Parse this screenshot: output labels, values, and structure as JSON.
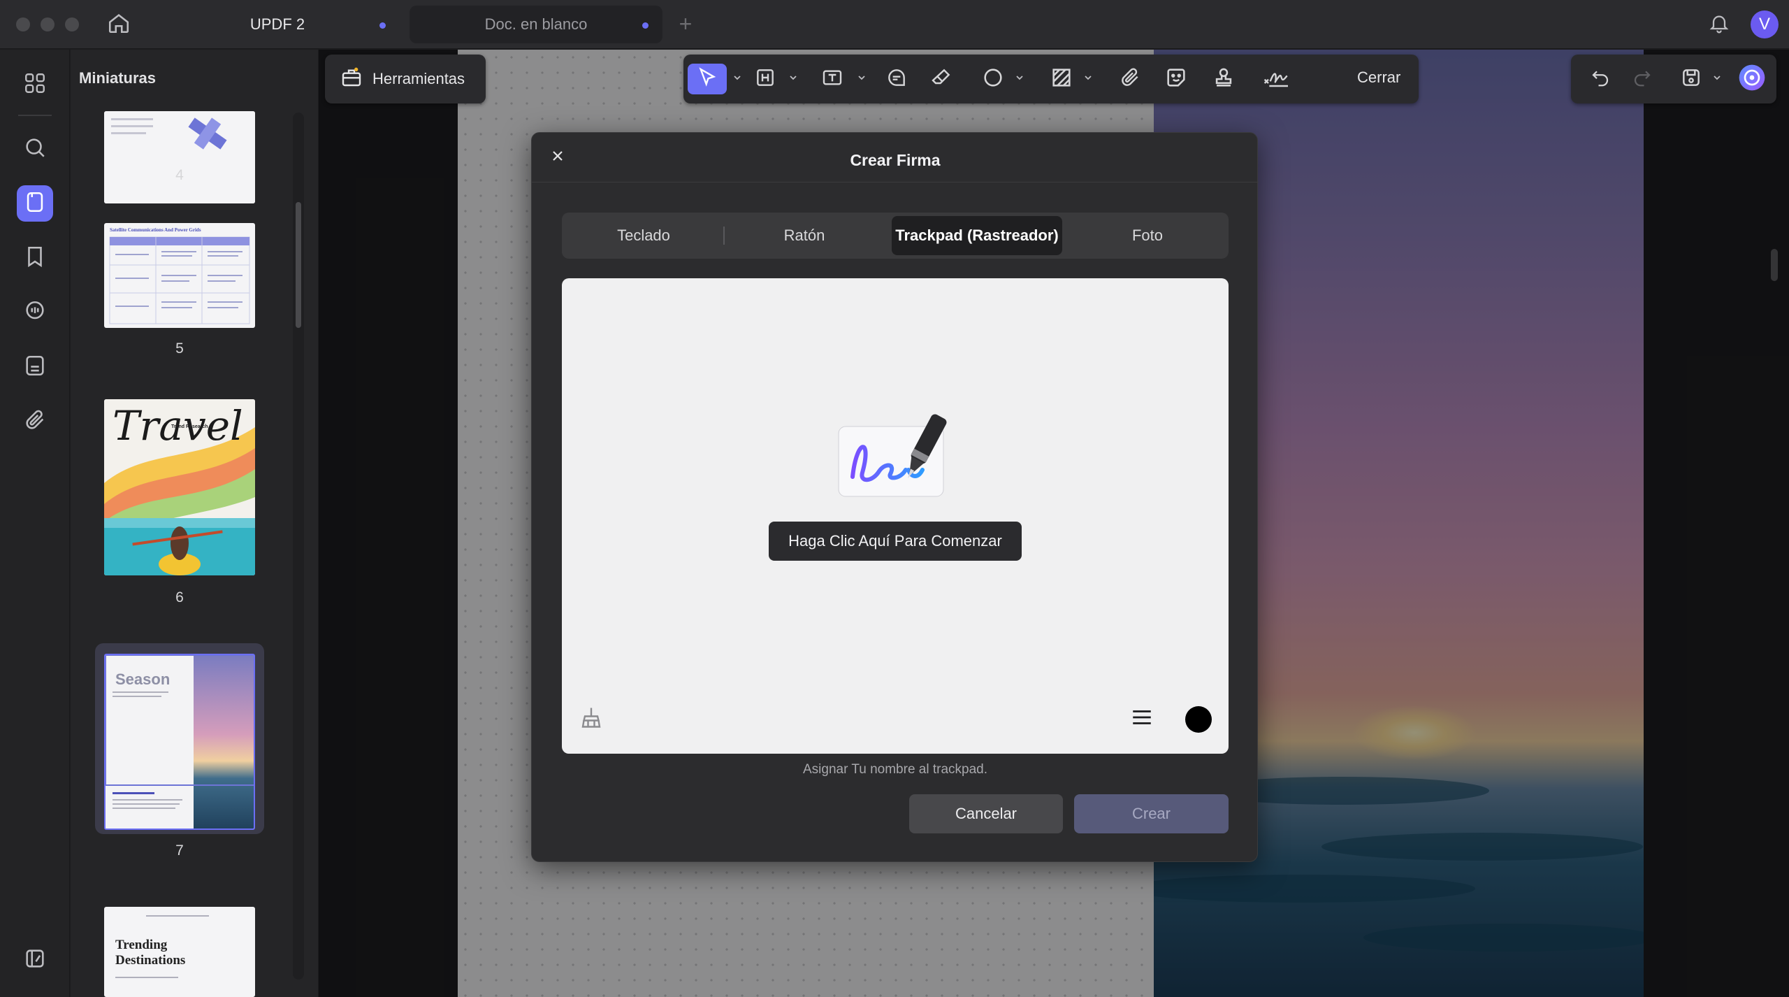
{
  "window": {
    "tabs": [
      {
        "label": "UPDF 2"
      },
      {
        "label": "Doc. en blanco"
      }
    ],
    "avatar_initial": "V"
  },
  "sidebar": {
    "panel_title": "Miniaturas",
    "thumbnails": [
      {
        "page": "4"
      },
      {
        "page": "5",
        "heading": "Satellite Communications And Power Grids"
      },
      {
        "page": "6",
        "heading": "Travel",
        "subheading": "Trend Research"
      },
      {
        "page": "7",
        "heading": "Season"
      },
      {
        "page": "",
        "heading": "Trending Destinations"
      }
    ]
  },
  "toolbar": {
    "tools_label": "Herramientas",
    "close_label": "Cerrar"
  },
  "dialog": {
    "title": "Crear Firma",
    "tabs": [
      {
        "label": "Teclado"
      },
      {
        "label": "Ratón"
      },
      {
        "label": "Trackpad (Rastreador)",
        "active": true
      },
      {
        "label": "Foto"
      }
    ],
    "start_button": "Haga Clic Aquí Para Comenzar",
    "hint": "Asignar Tu nombre al trackpad.",
    "cancel_label": "Cancelar",
    "create_label": "Crear",
    "ink_color": "#000000"
  },
  "colors": {
    "accent": "#6b6ff5",
    "background": "#1c1c1e"
  }
}
